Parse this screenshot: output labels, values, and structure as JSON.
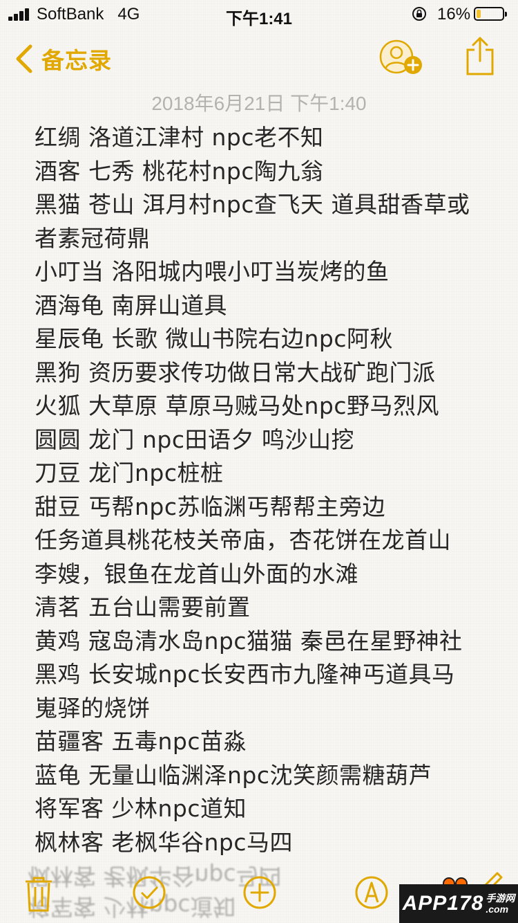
{
  "status_bar": {
    "carrier": "SoftBank",
    "network": "4G",
    "time": "下午1:41",
    "battery_percent": "16%",
    "battery_level": 0.16
  },
  "nav": {
    "back_label": "备忘录",
    "icons": [
      "chevron-left-icon",
      "add-person-icon",
      "share-icon"
    ]
  },
  "note": {
    "date": "2018年6月21日 下午1:40",
    "lines": [
      "红绸 洛道江津村 npc老不知",
      "酒客 七秀 桃花村npc陶九翁",
      "黑猫 苍山 洱月村npc查飞天 道具甜香草或",
      "者素冠荷鼎",
      "小叮当 洛阳城内喂小叮当炭烤的鱼",
      "酒海龟 南屏山道具",
      "星辰龟 长歌 微山书院右边npc阿秋",
      "黑狗 资历要求传功做日常大战矿跑门派",
      "火狐 大草原 草原马贼马处npc野马烈风",
      "圆圆 龙门 npc田语夕 鸣沙山挖",
      "刀豆 龙门npc桩桩",
      "甜豆 丐帮npc苏临渊丐帮帮主旁边",
      "任务道具桃花枝关帝庙，杏花饼在龙首山",
      "李嫂，银鱼在龙首山外面的水滩",
      "清茗 五台山需要前置",
      "黄鸡 寇岛清水岛npc猫猫 秦邑在星野神社",
      "黑鸡 长安城npc长安西市九隆神丐道具马",
      "嵬驿的烧饼",
      "苗疆客 五毒npc苗淼",
      "蓝龟 无量山临渊泽npc沈笑颜需糖葫芦",
      "将军客 少林npc道知",
      "枫林客 老枫华谷npc马四"
    ]
  },
  "toolbar": {
    "icons": [
      "trash-icon",
      "checklist-icon",
      "add-icon",
      "markup-icon",
      "compose-icon"
    ]
  },
  "watermark": {
    "brand": "APP178",
    "sub_top": "手游网",
    "sub_bottom": ".com"
  },
  "colors": {
    "accent": "#e0a800",
    "background": "#f7f6f2",
    "date_text": "#b4b2ad"
  }
}
